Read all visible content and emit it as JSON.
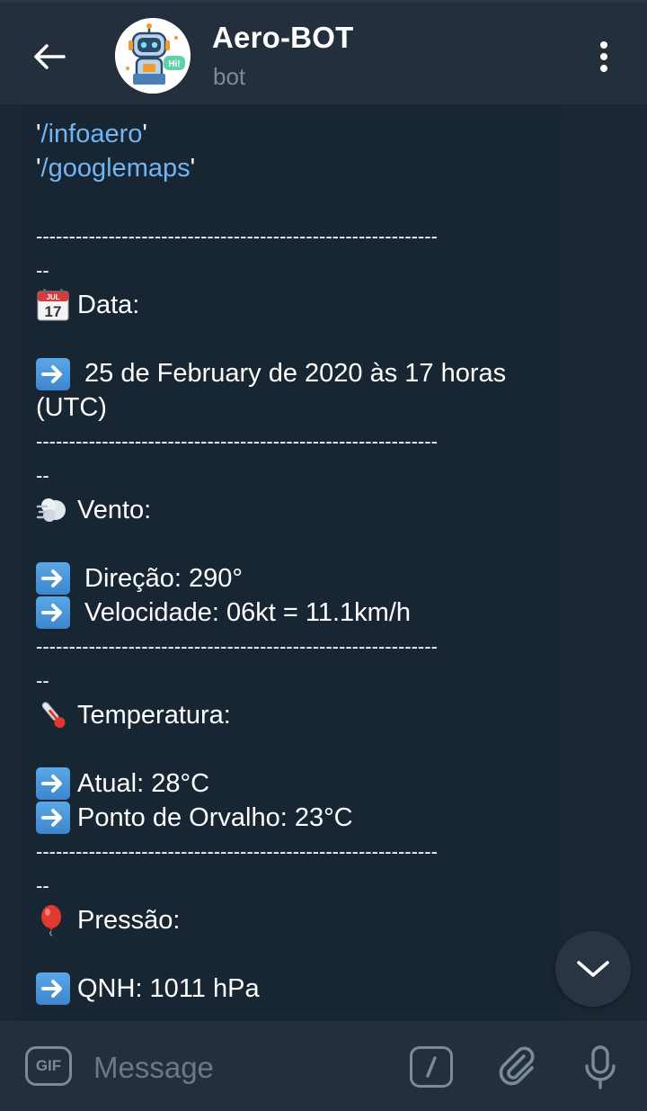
{
  "header": {
    "title": "Aero-BOT",
    "subtitle": "bot",
    "avatar_badge": "Hi!"
  },
  "message": {
    "commands": [
      {
        "open_quote": "'",
        "command": "/infoaero",
        "close_quote": "'"
      },
      {
        "open_quote": "'",
        "command": "/googlemaps",
        "close_quote": "'"
      }
    ],
    "separator": "-------------------------------------------------------------",
    "separator_tail": "--",
    "sections": {
      "data": {
        "icon": "calendar-icon",
        "calendar_month": "JUL",
        "calendar_day": "17",
        "heading": "Data:",
        "lines": [
          "25 de February de 2020 às 17 horas (UTC)"
        ]
      },
      "vento": {
        "icon": "wind-icon",
        "heading": "Vento:",
        "lines": [
          "Direção: 290°",
          "Velocidade: 06kt = 11.1km/h"
        ]
      },
      "temperatura": {
        "icon": "thermometer-icon",
        "heading": "Temperatura:",
        "lines": [
          "Atual: 28°C",
          "Ponto de Orvalho: 23°C"
        ]
      },
      "pressao": {
        "icon": "balloon-icon",
        "heading": "Pressão:",
        "lines": [
          "QNH: 1011 hPa"
        ]
      }
    }
  },
  "input_bar": {
    "gif_label": "GIF",
    "placeholder": "Message"
  },
  "colors": {
    "header_bg": "#242f3d",
    "chat_bg": "#1d2733",
    "bubble_bg": "#182533",
    "link": "#71b5f2",
    "muted": "#7b8a9a"
  }
}
